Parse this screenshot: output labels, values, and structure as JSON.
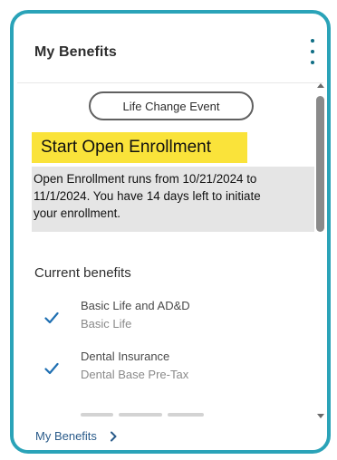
{
  "card": {
    "title": "My Benefits",
    "menu_icon": "more-vertical-icon",
    "border_color": "#2aa3b8"
  },
  "actions": {
    "life_change_label": "Life Change Event"
  },
  "enrollment": {
    "heading": "Start Open Enrollment",
    "heading_highlight": "#fae33a",
    "line1": "Open Enrollment runs from 10/21/2024 to",
    "line2": "11/1/2024. You have 14 days left to initiate",
    "line3": "your enrollment."
  },
  "current_benefits": {
    "label": "Current benefits",
    "check_color": "#1f6fb2",
    "items": [
      {
        "title": "Basic Life and AD&D",
        "subtitle": "Basic Life",
        "icon": "check-icon"
      },
      {
        "title": "Dental Insurance",
        "subtitle": "Dental Base Pre-Tax",
        "icon": "check-icon"
      }
    ]
  },
  "footer": {
    "link_label": "My Benefits",
    "link_icon": "chevron-right-icon"
  }
}
